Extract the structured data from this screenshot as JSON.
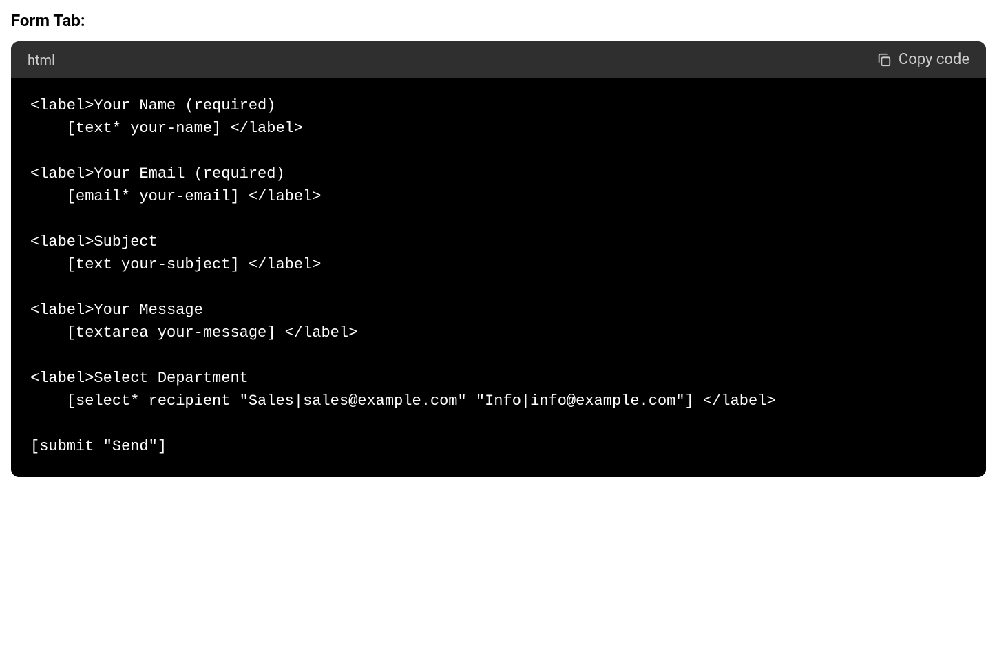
{
  "heading": "Form Tab:",
  "code": {
    "language": "html",
    "copy_label": "Copy code",
    "lines": [
      "<label>Your Name (required)",
      "    [text* your-name] </label>",
      "",
      "<label>Your Email (required)",
      "    [email* your-email] </label>",
      "",
      "<label>Subject",
      "    [text your-subject] </label>",
      "",
      "<label>Your Message",
      "    [textarea your-message] </label>",
      "",
      "<label>Select Department",
      "    [select* recipient \"Sales|sales@example.com\" \"Info|info@example.com\"] </label>",
      "",
      "[submit \"Send\"]"
    ]
  }
}
